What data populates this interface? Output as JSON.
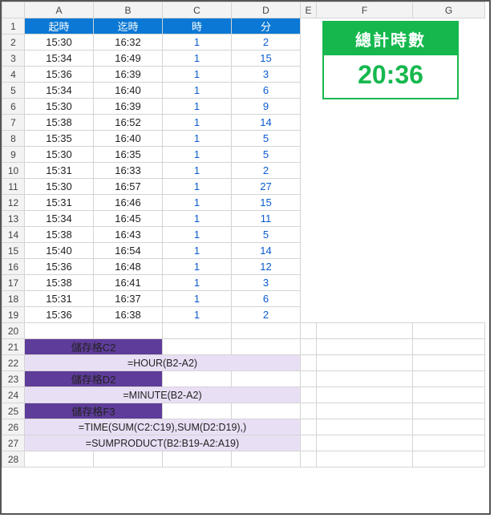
{
  "columns": [
    "A",
    "B",
    "C",
    "D",
    "E",
    "F",
    "G"
  ],
  "row_numbers": [
    1,
    2,
    3,
    4,
    5,
    6,
    7,
    8,
    9,
    10,
    11,
    12,
    13,
    14,
    15,
    16,
    17,
    18,
    19,
    20,
    21,
    22,
    23,
    24,
    25,
    26,
    27,
    28
  ],
  "header_row": {
    "A": "起時",
    "B": "迄時",
    "C": "時",
    "D": "分"
  },
  "data_rows": [
    {
      "A": "15:30",
      "B": "16:32",
      "C": "1",
      "D": "2"
    },
    {
      "A": "15:34",
      "B": "16:49",
      "C": "1",
      "D": "15"
    },
    {
      "A": "15:36",
      "B": "16:39",
      "C": "1",
      "D": "3"
    },
    {
      "A": "15:34",
      "B": "16:40",
      "C": "1",
      "D": "6"
    },
    {
      "A": "15:30",
      "B": "16:39",
      "C": "1",
      "D": "9"
    },
    {
      "A": "15:38",
      "B": "16:52",
      "C": "1",
      "D": "14"
    },
    {
      "A": "15:35",
      "B": "16:40",
      "C": "1",
      "D": "5"
    },
    {
      "A": "15:30",
      "B": "16:35",
      "C": "1",
      "D": "5"
    },
    {
      "A": "15:31",
      "B": "16:33",
      "C": "1",
      "D": "2"
    },
    {
      "A": "15:30",
      "B": "16:57",
      "C": "1",
      "D": "27"
    },
    {
      "A": "15:31",
      "B": "16:46",
      "C": "1",
      "D": "15"
    },
    {
      "A": "15:34",
      "B": "16:45",
      "C": "1",
      "D": "11"
    },
    {
      "A": "15:38",
      "B": "16:43",
      "C": "1",
      "D": "5"
    },
    {
      "A": "15:40",
      "B": "16:54",
      "C": "1",
      "D": "14"
    },
    {
      "A": "15:36",
      "B": "16:48",
      "C": "1",
      "D": "12"
    },
    {
      "A": "15:38",
      "B": "16:41",
      "C": "1",
      "D": "3"
    },
    {
      "A": "15:31",
      "B": "16:37",
      "C": "1",
      "D": "6"
    },
    {
      "A": "15:36",
      "B": "16:38",
      "C": "1",
      "D": "2"
    }
  ],
  "formula_block": {
    "c2_label": "儲存格C2",
    "c2_formula": "=HOUR(B2-A2)",
    "d2_label": "儲存格D2",
    "d2_formula": "=MINUTE(B2-A2)",
    "f3_label": "儲存格F3",
    "f3_formula1": "=TIME(SUM(C2:C19),SUM(D2:D19),)",
    "f3_formula2": "=SUMPRODUCT(B2:B19-A2:A19)"
  },
  "total": {
    "title": "總計時數",
    "value": "20:36"
  }
}
